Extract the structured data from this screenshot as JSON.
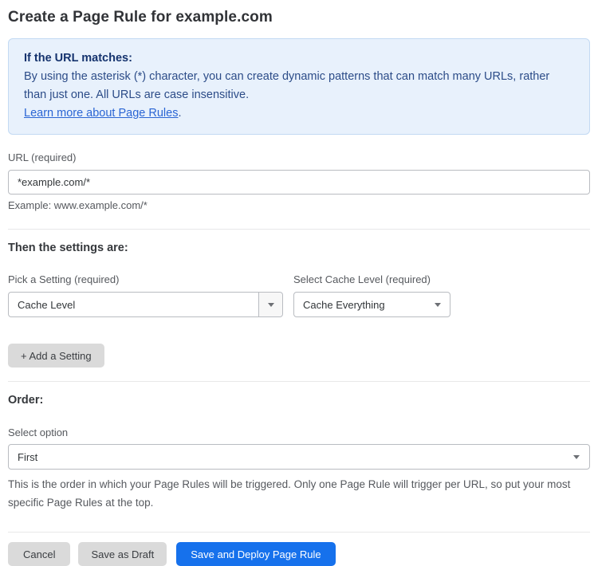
{
  "page": {
    "title": "Create a Page Rule for example.com"
  },
  "info_box": {
    "heading": "If the URL matches:",
    "body": "By using the asterisk (*) character, you can create dynamic patterns that can match many URLs, rather than just one. All URLs are case insensitive.",
    "link_label": "Learn more about Page Rules",
    "link_suffix": "."
  },
  "url_field": {
    "label": "URL (required)",
    "value": "*example.com/*",
    "helper": "Example: www.example.com/*"
  },
  "settings_section": {
    "heading": "Then the settings are:",
    "setting_picker": {
      "label": "Pick a Setting (required)",
      "value": "Cache Level"
    },
    "cache_level_picker": {
      "label": "Select Cache Level (required)",
      "value": "Cache Everything"
    },
    "add_setting_label": "+ Add a Setting"
  },
  "order_section": {
    "heading": "Order:",
    "label": "Select option",
    "value": "First",
    "helper": "This is the order in which your Page Rules will be triggered. Only one Page Rule will trigger per URL, so put your most specific Page Rules at the top."
  },
  "actions": {
    "cancel_label": "Cancel",
    "save_draft_label": "Save as Draft",
    "save_deploy_label": "Save and Deploy Page Rule"
  },
  "colors": {
    "info_bg": "#e8f1fc",
    "info_border": "#c3daf3",
    "info_heading_text": "#15336e",
    "info_body_text": "#2c4c88",
    "link_blue": "#2a65d4",
    "primary_button_blue": "#1671ec",
    "secondary_button_gray": "#dadada"
  }
}
